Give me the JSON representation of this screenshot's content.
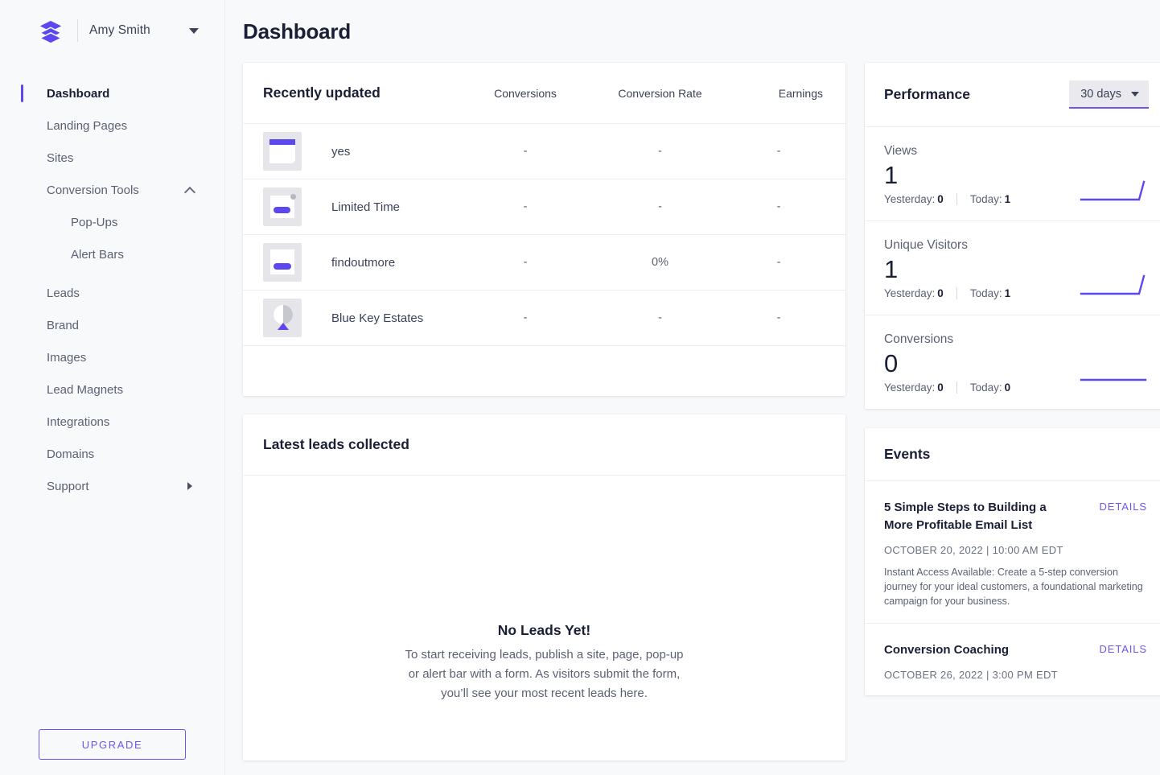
{
  "sidebar": {
    "logo_icon": "layers-stack-icon",
    "account_name": "Amy Smith",
    "account_caret_icon": "chevron-down-icon",
    "items": [
      {
        "label": "Dashboard",
        "active": true,
        "sub": false,
        "icon": ""
      },
      {
        "label": "Landing Pages",
        "active": false,
        "sub": false,
        "icon": ""
      },
      {
        "label": "Sites",
        "active": false,
        "sub": false,
        "icon": ""
      },
      {
        "label": "Conversion Tools",
        "active": false,
        "sub": false,
        "icon": "chevron-up-icon"
      },
      {
        "label": "Pop-Ups",
        "active": false,
        "sub": true,
        "icon": ""
      },
      {
        "label": "Alert Bars",
        "active": false,
        "sub": true,
        "icon": ""
      },
      {
        "label": "Leads",
        "active": false,
        "sub": false,
        "icon": ""
      },
      {
        "label": "Brand",
        "active": false,
        "sub": false,
        "icon": ""
      },
      {
        "label": "Images",
        "active": false,
        "sub": false,
        "icon": ""
      },
      {
        "label": "Lead Magnets",
        "active": false,
        "sub": false,
        "icon": ""
      },
      {
        "label": "Integrations",
        "active": false,
        "sub": false,
        "icon": ""
      },
      {
        "label": "Domains",
        "active": false,
        "sub": false,
        "icon": ""
      },
      {
        "label": "Support",
        "active": false,
        "sub": false,
        "icon": "chevron-right-icon"
      }
    ],
    "upgrade_label": "UPGRADE"
  },
  "header": {
    "title": "Dashboard"
  },
  "recently_updated": {
    "title": "Recently updated",
    "columns": [
      "Conversions",
      "Conversion Rate",
      "Earnings"
    ],
    "rows": [
      {
        "name": "yes",
        "thumb": "landing-page-thumb",
        "conversions": "-",
        "conversion_rate": "-",
        "earnings": "-"
      },
      {
        "name": "Limited Time",
        "thumb": "pop-up-thumb",
        "conversions": "-",
        "conversion_rate": "-",
        "earnings": "-"
      },
      {
        "name": "findoutmore",
        "thumb": "alert-bar-thumb",
        "conversions": "-",
        "conversion_rate": "0%",
        "earnings": "-"
      },
      {
        "name": "Blue Key Estates",
        "thumb": "site-thumb",
        "conversions": "-",
        "conversion_rate": "-",
        "earnings": "-"
      }
    ]
  },
  "latest_leads": {
    "title": "Latest leads collected",
    "empty_title": "No Leads Yet!",
    "empty_body": "To start receiving leads, publish a site, page, pop-up or alert bar with a form. As visitors submit the form, you’ll see your most recent leads here."
  },
  "performance": {
    "title": "Performance",
    "range_value": "30 days",
    "range_caret_icon": "chevron-down-icon",
    "yesterday_label": "Yesterday:",
    "today_label": "Today:",
    "metrics": [
      {
        "label": "Views",
        "value": "1",
        "yesterday": "0",
        "today": "1",
        "spark": "rise"
      },
      {
        "label": "Unique Visitors",
        "value": "1",
        "yesterday": "0",
        "today": "1",
        "spark": "rise"
      },
      {
        "label": "Conversions",
        "value": "0",
        "yesterday": "0",
        "today": "0",
        "spark": "flat"
      }
    ]
  },
  "events": {
    "title": "Events",
    "details_label": "DETAILS",
    "items": [
      {
        "name": "5 Simple Steps to Building a More Profitable Email List",
        "date": "OCTOBER 20, 2022 | 10:00 AM EDT",
        "description": "Instant Access Available: Create a 5-step conversion journey for your ideal customers, a foundational marketing campaign for your business."
      },
      {
        "name": "Conversion Coaching",
        "date": "OCTOBER 26, 2022 | 3:00 PM EDT",
        "description": ""
      }
    ]
  },
  "colors": {
    "accent": "#5c48ee",
    "accent_link": "#6b57ef",
    "page_bg": "#f8f9fb",
    "card_bg": "#ffffff",
    "text_dark": "#1a1f36",
    "text_muted": "#5b6172",
    "border": "#edeef2"
  }
}
